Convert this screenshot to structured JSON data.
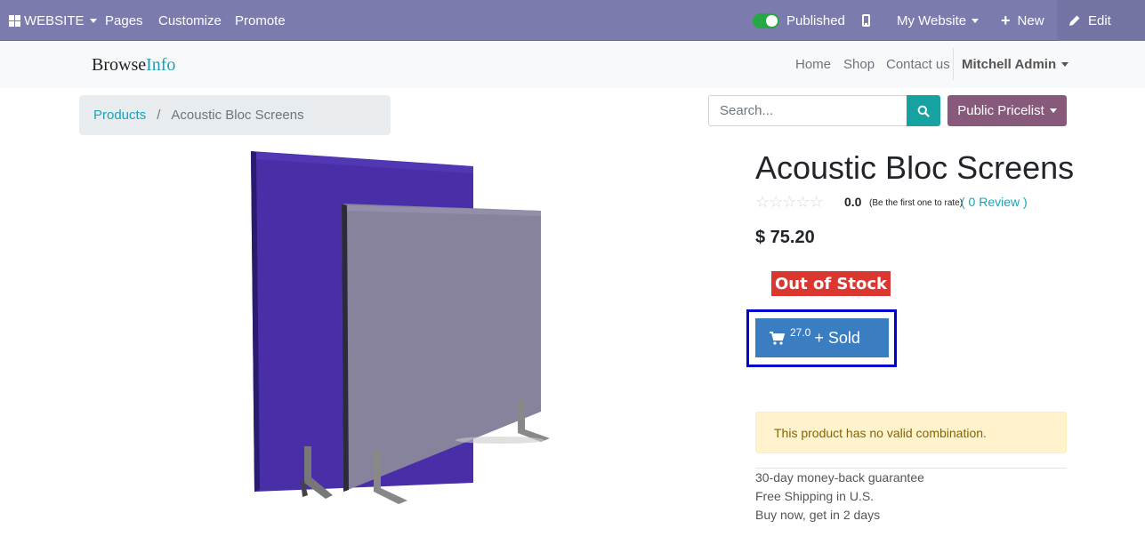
{
  "adminbar": {
    "website_label": "WEBSITE",
    "pages_label": "Pages",
    "customize_label": "Customize",
    "promote_label": "Promote",
    "published_label": "Published",
    "my_website_label": "My Website",
    "new_label": "New",
    "edit_label": "Edit"
  },
  "sitenav": {
    "brand_part1": "Browse",
    "brand_part2": "Info",
    "links": [
      "Home",
      "Shop",
      "Contact us"
    ],
    "user": "Mitchell Admin"
  },
  "breadcrumb": {
    "parent": "Products",
    "separator": "/",
    "current": "Acoustic Bloc Screens"
  },
  "search": {
    "placeholder": "Search..."
  },
  "pricelist": {
    "label": "Public Pricelist"
  },
  "product": {
    "title": "Acoustic Bloc Screens",
    "rating_value": "0.0",
    "rating_note": "(Be the first one to rate)",
    "review_link": "( 0 Review )",
    "price": "$ 75.20",
    "stock_badge": "Out of Stock",
    "sold_count": "27.0",
    "sold_label": "+ Sold",
    "alert_text": "This product has no valid combination.",
    "features": [
      "30-day money-back guarantee",
      "Free Shipping in U.S.",
      "Buy now, get in 2 days"
    ]
  },
  "colors": {
    "adminbar": "#7c7bad",
    "accent": "#17a2b8",
    "pricelist": "#875a7b",
    "out_of_stock": "#d9372f",
    "sold_button": "#3a7dc0"
  }
}
